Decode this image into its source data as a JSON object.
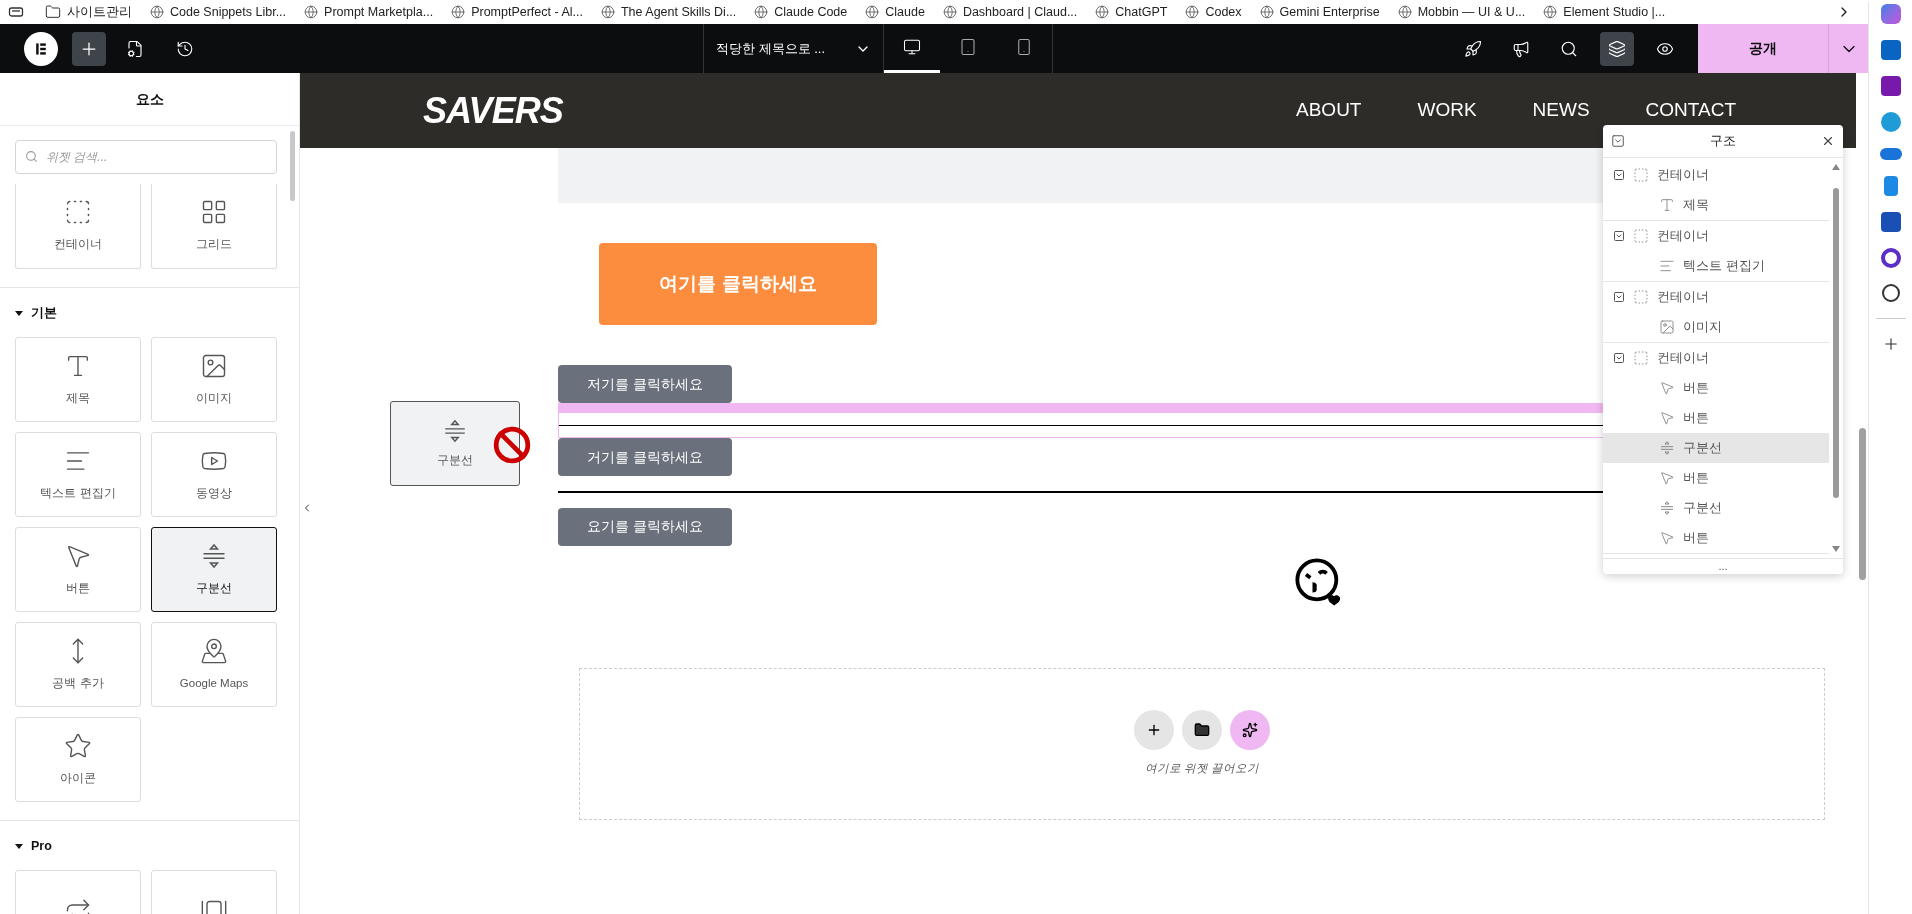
{
  "bookmarks": [
    {
      "label": "사이트관리",
      "kind": "folder"
    },
    {
      "label": "Code Snippets Libr...",
      "kind": "site"
    },
    {
      "label": "Prompt Marketpla...",
      "kind": "site"
    },
    {
      "label": "PromptPerfect - Al...",
      "kind": "site"
    },
    {
      "label": "The Agent Skills Di...",
      "kind": "site"
    },
    {
      "label": "Claude Code",
      "kind": "site"
    },
    {
      "label": "Claude",
      "kind": "site"
    },
    {
      "label": "Dashboard | Claud...",
      "kind": "site"
    },
    {
      "label": "ChatGPT",
      "kind": "site"
    },
    {
      "label": "Codex",
      "kind": "site"
    },
    {
      "label": "Gemini Enterprise",
      "kind": "site"
    },
    {
      "label": "Mobbin — UI & U...",
      "kind": "site"
    },
    {
      "label": "Element Studio |...",
      "kind": "site"
    }
  ],
  "toolbar": {
    "page_title": "적당한 제목으로 ...",
    "devices": [
      {
        "kind": "desktop",
        "selected": true
      },
      {
        "kind": "tablet",
        "selected": false
      },
      {
        "kind": "mobile",
        "selected": false
      }
    ],
    "tools": [
      {
        "kind": "rocket",
        "selected": false
      },
      {
        "kind": "megaphone",
        "selected": false
      },
      {
        "kind": "search",
        "selected": false
      },
      {
        "kind": "layers",
        "selected": true
      },
      {
        "kind": "preview",
        "selected": false
      }
    ],
    "publish": "공개"
  },
  "panel": {
    "title": "요소",
    "search_placeholder": "위젯 검색...",
    "sections": [
      {
        "widgets": [
          {
            "kind": "container",
            "label": "컨테이너",
            "selected": false
          },
          {
            "kind": "grid",
            "label": "그리드",
            "selected": false
          }
        ]
      },
      {
        "heading": "기본",
        "widgets": [
          {
            "kind": "heading",
            "label": "제목",
            "selected": false
          },
          {
            "kind": "image",
            "label": "이미지",
            "selected": false
          },
          {
            "kind": "text",
            "label": "텍스트 편집기",
            "selected": false
          },
          {
            "kind": "video",
            "label": "동영상",
            "selected": false
          },
          {
            "kind": "button",
            "label": "버튼",
            "selected": false
          },
          {
            "kind": "divider",
            "label": "구분선",
            "selected": true
          },
          {
            "kind": "spacer",
            "label": "공백 추가",
            "selected": false
          },
          {
            "kind": "maps",
            "label": "Google Maps",
            "selected": false
          },
          {
            "kind": "icon",
            "label": "아이콘",
            "selected": false
          }
        ]
      },
      {
        "heading": "Pro",
        "widgets": [
          {
            "kind": "loop",
            "selected": false
          },
          {
            "kind": "carousel",
            "selected": false
          }
        ]
      }
    ]
  },
  "site": {
    "logo": "SAVERS",
    "nav": [
      "ABOUT",
      "WORK",
      "NEWS",
      "CONTACT"
    ],
    "cta": "여기를 클릭하세요",
    "blocks": [
      {
        "kind": "button",
        "label": "저기를 클릭하세요"
      },
      {
        "kind": "divider",
        "highlighted": true
      },
      {
        "kind": "button",
        "label": "거기를 클릭하세요"
      },
      {
        "kind": "divider",
        "highlighted": false
      },
      {
        "kind": "button",
        "label": "요기를 클릭하세요"
      }
    ],
    "drag_ghost": {
      "label": "구분선"
    },
    "drop_zone": {
      "hint": "여기로 위젯 끌어오기"
    }
  },
  "structure": {
    "title": "구조",
    "items": [
      {
        "kind": "container",
        "label": "컨테이너",
        "expanded": true,
        "selected": false,
        "children": [
          {
            "kind": "heading",
            "label": "제목",
            "selected": false
          }
        ]
      },
      {
        "kind": "container",
        "label": "컨테이너",
        "expanded": true,
        "selected": false,
        "children": [
          {
            "kind": "text",
            "label": "텍스트 편집기",
            "selected": false
          }
        ]
      },
      {
        "kind": "container",
        "label": "컨테이너",
        "expanded": true,
        "selected": false,
        "children": [
          {
            "kind": "image",
            "label": "이미지",
            "selected": false
          }
        ]
      },
      {
        "kind": "container",
        "label": "컨테이너",
        "expanded": true,
        "selected": false,
        "children": [
          {
            "kind": "button",
            "label": "버튼",
            "selected": false
          },
          {
            "kind": "button",
            "label": "버튼",
            "selected": false
          },
          {
            "kind": "divider",
            "label": "구분선",
            "selected": true
          },
          {
            "kind": "button",
            "label": "버튼",
            "selected": false
          },
          {
            "kind": "divider",
            "label": "구분선",
            "selected": false
          },
          {
            "kind": "button",
            "label": "버튼",
            "selected": false
          }
        ]
      }
    ],
    "more": "..."
  }
}
